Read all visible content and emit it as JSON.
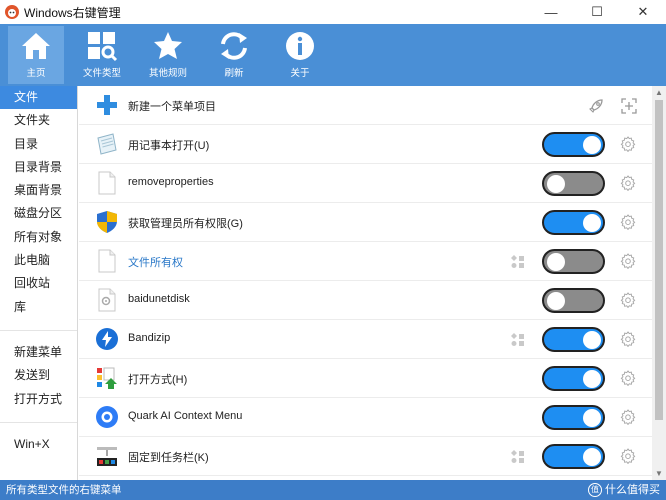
{
  "window": {
    "title": "Windows右键管理",
    "minimize": "—",
    "maximize": "☐",
    "close": "✕"
  },
  "toolbar": {
    "items": [
      {
        "label": "主页",
        "icon": "home-icon",
        "active": true
      },
      {
        "label": "文件类型",
        "icon": "file-types-icon",
        "active": false
      },
      {
        "label": "其他规则",
        "icon": "star-icon",
        "active": false
      },
      {
        "label": "刷新",
        "icon": "refresh-icon",
        "active": false
      },
      {
        "label": "关于",
        "icon": "info-icon",
        "active": false
      }
    ]
  },
  "sidebar": {
    "group1": [
      "文件",
      "文件夹",
      "目录",
      "目录背景",
      "桌面背景",
      "磁盘分区",
      "所有对象",
      "此电脑",
      "回收站",
      "库"
    ],
    "group2": [
      "新建菜单",
      "发送到",
      "打开方式"
    ],
    "group3": [
      "Win+X"
    ],
    "active_index": 0
  },
  "list": {
    "new_item": {
      "label": "新建一个菜单项目",
      "icon": "plus-icon"
    },
    "rows": [
      {
        "label": "用记事本打开(U)",
        "icon": "notepad-icon",
        "enabled": true,
        "tiles": false,
        "link": false
      },
      {
        "label": "removeproperties",
        "icon": "blank-file-icon",
        "enabled": false,
        "tiles": false,
        "link": false
      },
      {
        "label": "获取管理员所有权限(G)",
        "icon": "uac-shield-icon",
        "enabled": true,
        "tiles": false,
        "link": false
      },
      {
        "label": "文件所有权",
        "icon": "blank-file-icon",
        "enabled": false,
        "tiles": true,
        "link": true
      },
      {
        "label": "baidunetdisk",
        "icon": "gear-file-icon",
        "enabled": false,
        "tiles": false,
        "link": false
      },
      {
        "label": "Bandizip",
        "icon": "bandizip-icon",
        "enabled": true,
        "tiles": true,
        "link": false
      },
      {
        "label": "打开方式(H)",
        "icon": "open-with-icon",
        "enabled": true,
        "tiles": false,
        "link": false
      },
      {
        "label": "Quark AI Context Menu",
        "icon": "quark-icon",
        "enabled": true,
        "tiles": false,
        "link": false
      },
      {
        "label": "固定到任务栏(K)",
        "icon": "taskbar-pin-icon",
        "enabled": true,
        "tiles": true,
        "link": false
      }
    ]
  },
  "status": {
    "text": "所有类型文件的右键菜单",
    "watermark": "什么值得买"
  },
  "colors": {
    "toolbar": "#4a8fd6",
    "accent": "#3d8ae0",
    "toggle_on": "#1e8ef2",
    "toggle_off": "#8b8b8b",
    "status": "#3d7dc8"
  }
}
